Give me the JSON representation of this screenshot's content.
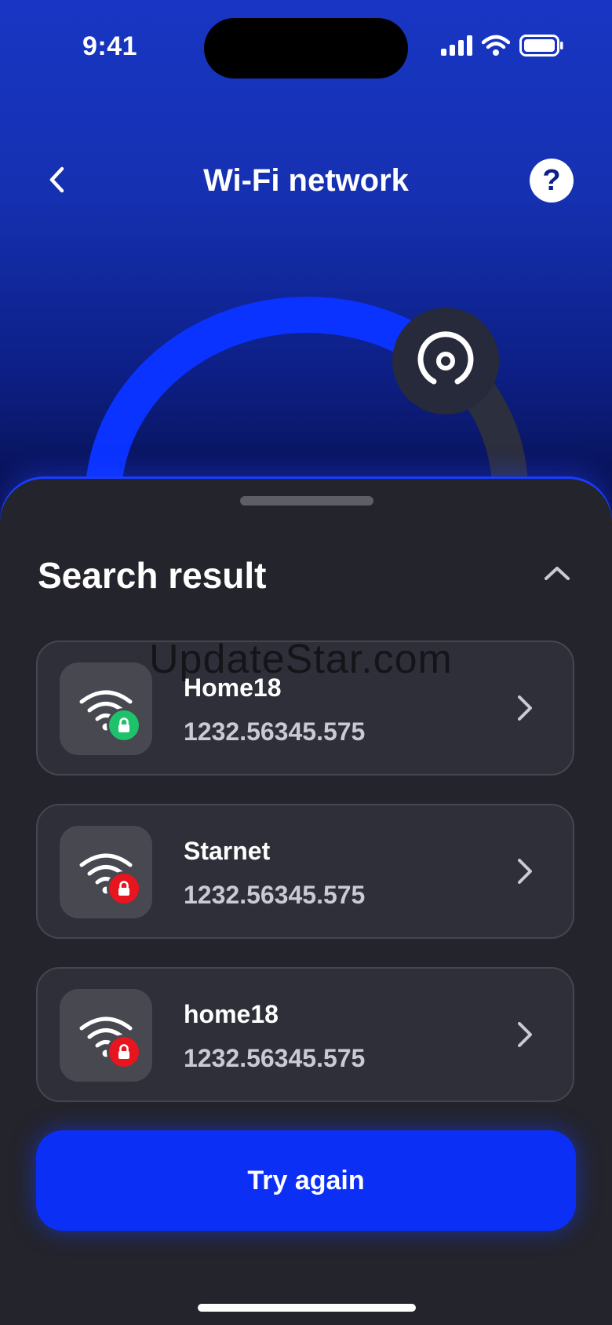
{
  "status_bar": {
    "time": "9:41"
  },
  "header": {
    "title": "Wi-Fi network",
    "help_label": "?"
  },
  "sheet": {
    "title": "Search result",
    "watermark": "UpdateStar.com",
    "networks": [
      {
        "name": "Home18",
        "address": "1232.56345.575",
        "lock_status": "secured",
        "lock_color": "#1ec26b"
      },
      {
        "name": "Starnet",
        "address": "1232.56345.575",
        "lock_status": "locked",
        "lock_color": "#e8141e"
      },
      {
        "name": "home18",
        "address": "1232.56345.575",
        "lock_status": "locked",
        "lock_color": "#e8141e"
      }
    ],
    "action_label": "Try again"
  },
  "colors": {
    "accent": "#0b2ff5",
    "sheet_bg": "#24242c",
    "card_bg": "#2e2f38"
  },
  "icons": [
    "back-arrow-icon",
    "help-icon",
    "radar-icon",
    "chevron-up-icon",
    "wifi-icon",
    "lock-icon",
    "chevron-right-icon"
  ]
}
